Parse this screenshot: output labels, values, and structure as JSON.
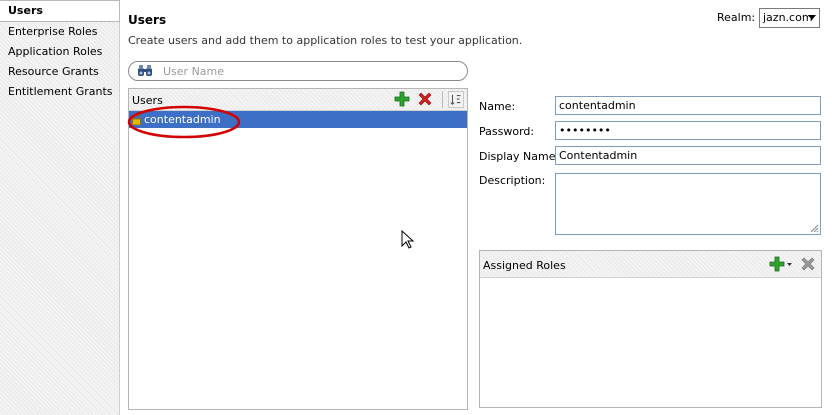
{
  "nav": {
    "items": [
      {
        "label": "Users",
        "selected": true
      },
      {
        "label": "Enterprise Roles",
        "selected": false
      },
      {
        "label": "Application Roles",
        "selected": false
      },
      {
        "label": "Resource Grants",
        "selected": false
      },
      {
        "label": "Entitlement Grants",
        "selected": false
      }
    ]
  },
  "header": {
    "title": "Users",
    "subtitle": "Create users and add them to application roles to test your application.",
    "realm_label": "Realm:",
    "realm_value": "jazn.com"
  },
  "search": {
    "placeholder": "User Name",
    "value": ""
  },
  "users_list": {
    "header": "Users",
    "rows": [
      {
        "name": "contentadmin",
        "selected": true
      }
    ]
  },
  "details": {
    "name_label": "Name:",
    "name_value": "contentadmin",
    "password_label": "Password:",
    "password_value": "••••••••",
    "display_name_label": "Display Name:",
    "display_name_value": "Contentadmin",
    "description_label": "Description:",
    "description_value": ""
  },
  "assigned_roles": {
    "header": "Assigned Roles",
    "rows": []
  },
  "colors": {
    "selection": "#3d6fc6",
    "add_green": "#2ea12e",
    "delete_red": "#d42020",
    "annotation_red": "#d40000"
  },
  "icons": [
    "binoculars-icon",
    "add-icon",
    "delete-icon",
    "sort-icon",
    "lock-icon",
    "add-dropdown-icon",
    "remove-icon",
    "mouse-cursor-icon"
  ]
}
